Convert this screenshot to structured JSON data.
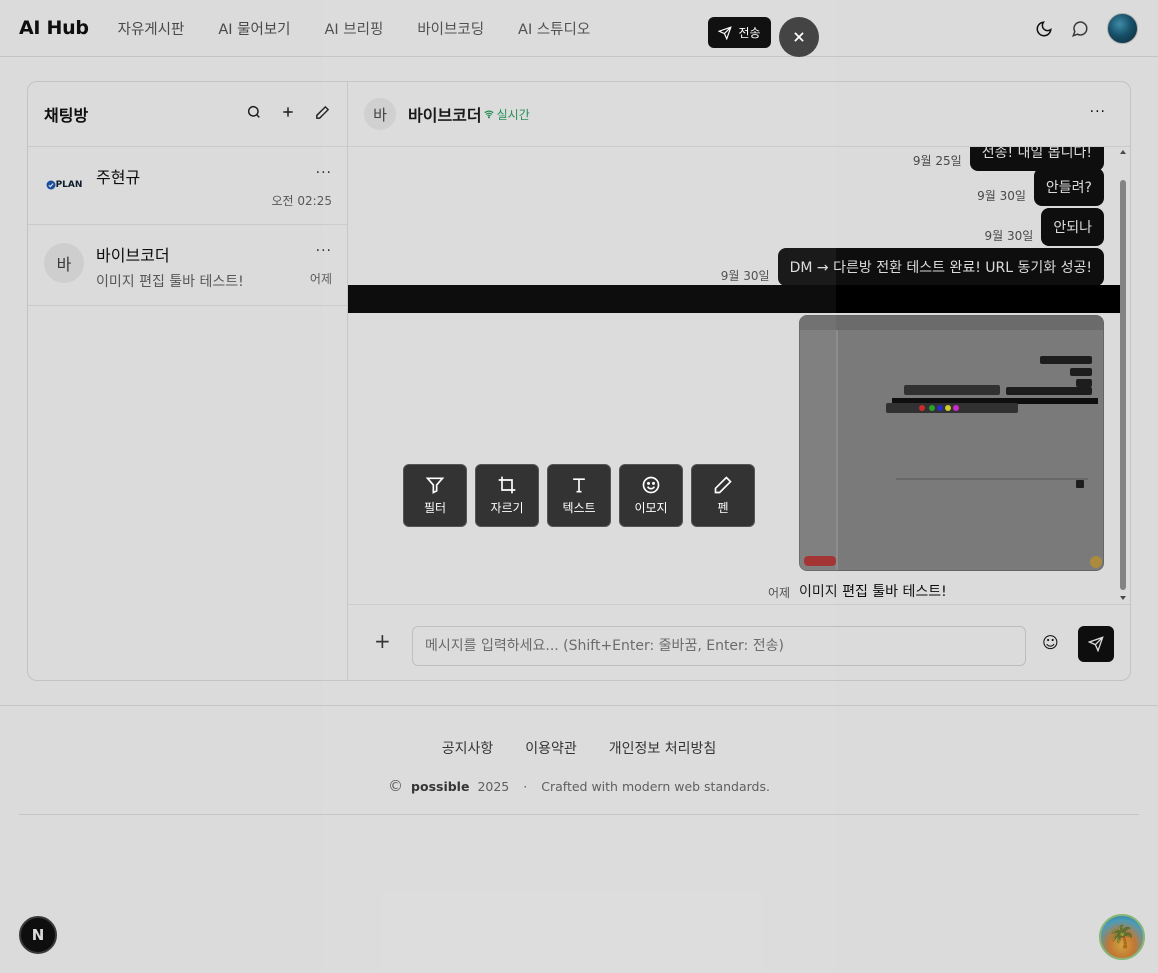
{
  "header": {
    "logo": "AI Hub",
    "nav": [
      "자유게시판",
      "AI 물어보기",
      "AI 브리핑",
      "바이브코딩",
      "AI 스튜디오"
    ]
  },
  "sidebar": {
    "title": "채팅방",
    "rooms": [
      {
        "avatar": "PLAN",
        "name": "주현규",
        "last": "",
        "time": "오전 02:25"
      },
      {
        "avatar": "바",
        "name": "바이브코더",
        "last": "이미지 편집 툴바 테스트!",
        "time": "어제"
      }
    ]
  },
  "chat": {
    "avatar": "바",
    "name": "바이브코더",
    "status": "실시간",
    "messages": [
      {
        "time": "9월 25일",
        "text": "전송! 내일 봅니다!"
      },
      {
        "time": "9월 30일",
        "text": "안들려?"
      },
      {
        "time": "9월 30일",
        "text": "안되나"
      },
      {
        "time": "9월 30일",
        "text": "DM → 다른방 전환 테스트 완료! URL 동기화 성공!"
      }
    ],
    "image_caption_time": "어제",
    "image_caption": "이미지 편집 툴바 테스트!",
    "input_placeholder": "메시지를 입력하세요... (Shift+Enter: 줄바꿈, Enter: 전송)"
  },
  "editor": {
    "send_label": "전송",
    "tools": [
      "필터",
      "자르기",
      "텍스트",
      "이모지",
      "펜"
    ]
  },
  "footer": {
    "links": [
      "공지사항",
      "이용약관",
      "개인정보 처리방침"
    ],
    "brand": "possible",
    "year": "2025",
    "separator": "·",
    "tagline": "Crafted with modern web standards."
  },
  "colors": {
    "live": "#22a05b",
    "bubble": "#111111"
  }
}
